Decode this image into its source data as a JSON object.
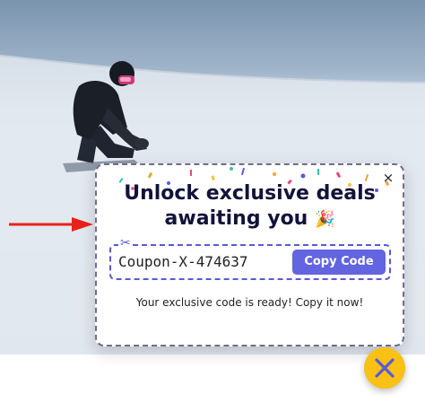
{
  "popup": {
    "title_line1": "Unlock exclusive deals",
    "title_line2": "awaiting you",
    "title_emoji": "🎉",
    "close_symbol": "×",
    "coupon_code": "Coupon-X-474637",
    "copy_button_label": "Copy Code",
    "message": "Your exclusive code is ready! Copy it now!",
    "scissors_symbol": "✂"
  },
  "icons": {
    "popup_close": "close-icon",
    "fab_close": "close-icon",
    "scissors": "scissors-icon",
    "arrow": "arrow-right-icon",
    "party": "party-popper-icon"
  },
  "colors": {
    "accent": "#6264e0",
    "fab": "#f8c114",
    "title": "#12123a",
    "arrow": "#e8221b",
    "dashed_border": "#5a5ad6"
  }
}
